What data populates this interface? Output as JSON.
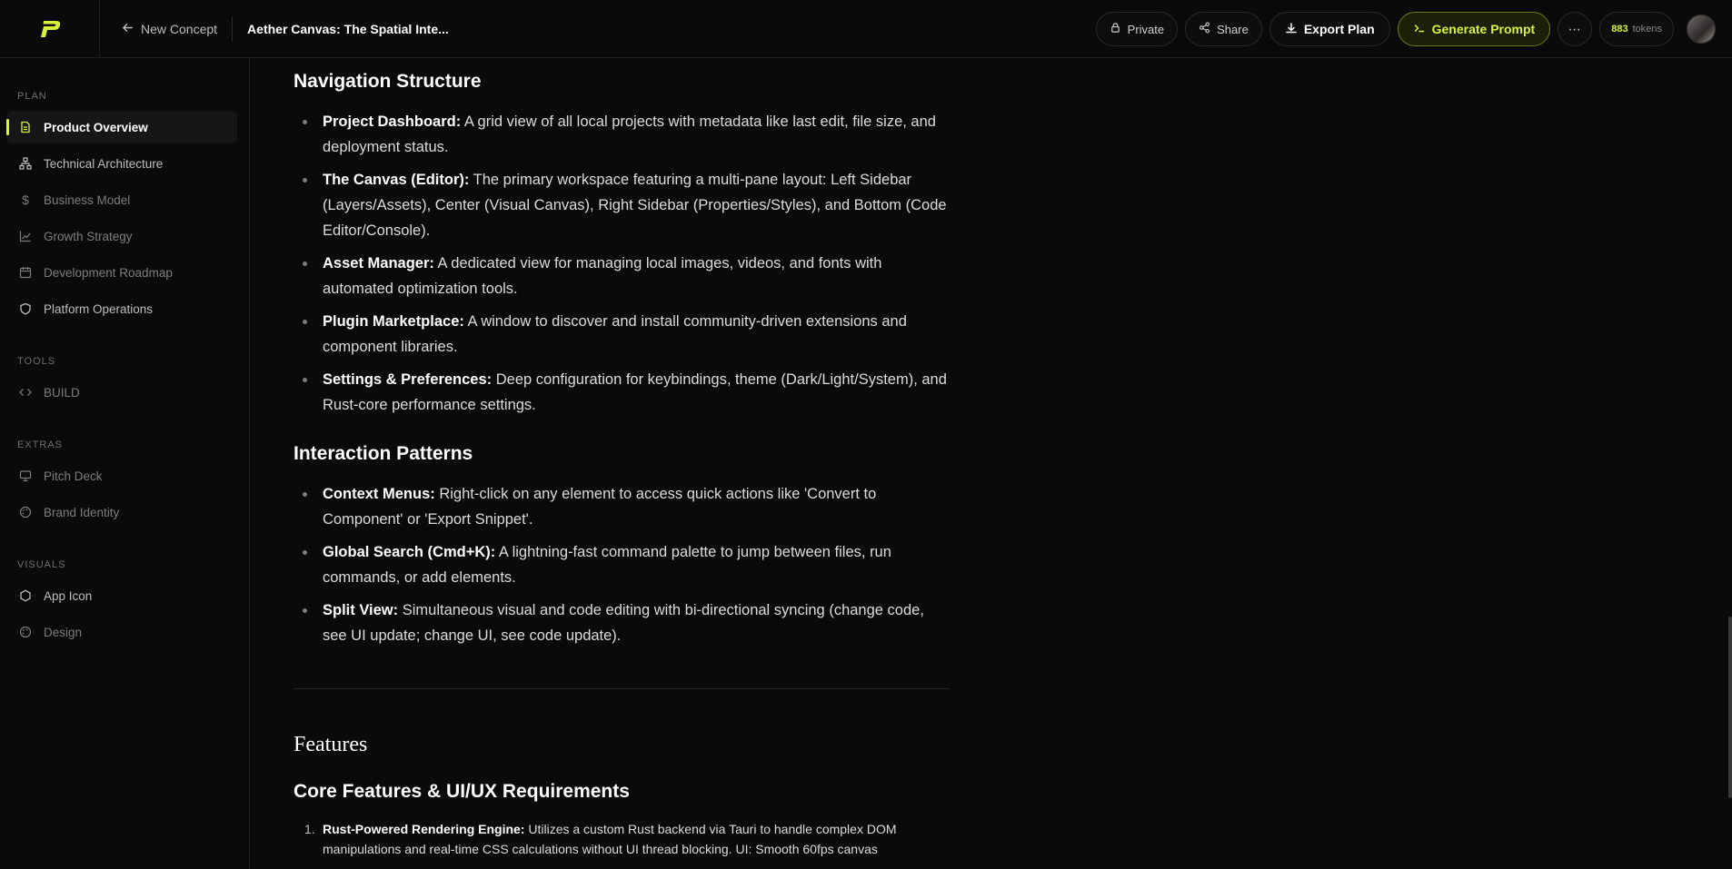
{
  "app": {
    "title": "Aether Canvas: The Spatial Inte...",
    "back_label": "New Concept"
  },
  "toolbar": {
    "private_label": "Private",
    "share_label": "Share",
    "export_label": "Export Plan",
    "generate_label": "Generate Prompt",
    "tokens_count": "883",
    "tokens_label": "tokens"
  },
  "colors": {
    "accent": "#d8f23a",
    "background": "#0a0a0a"
  },
  "sidebar": {
    "sections": [
      {
        "label": "PLAN",
        "items": [
          {
            "label": "Product Overview",
            "icon": "document-icon"
          },
          {
            "label": "Technical Architecture",
            "icon": "network-icon"
          },
          {
            "label": "Business Model",
            "icon": "dollar-icon"
          },
          {
            "label": "Growth Strategy",
            "icon": "chart-icon"
          },
          {
            "label": "Development Roadmap",
            "icon": "calendar-icon"
          },
          {
            "label": "Platform Operations",
            "icon": "shield-icon"
          }
        ]
      },
      {
        "label": "TOOLS",
        "items": [
          {
            "label": "BUILD",
            "icon": "code-icon"
          }
        ]
      },
      {
        "label": "EXTRAS",
        "items": [
          {
            "label": "Pitch Deck",
            "icon": "presentation-icon"
          },
          {
            "label": "Brand Identity",
            "icon": "palette-icon"
          }
        ]
      },
      {
        "label": "VISUALS",
        "items": [
          {
            "label": "App Icon",
            "icon": "hexagon-icon"
          },
          {
            "label": "Design",
            "icon": "palette-icon"
          }
        ]
      }
    ]
  },
  "main": {
    "navigation": {
      "heading": "Navigation Structure",
      "items": [
        {
          "term": "Project Dashboard:",
          "text": " A grid view of all local projects with metadata like last edit, file size, and deployment status."
        },
        {
          "term": "The Canvas (Editor):",
          "text": " The primary workspace featuring a multi-pane layout: Left Sidebar (Layers/Assets), Center (Visual Canvas), Right Sidebar (Properties/Styles), and Bottom (Code Editor/Console)."
        },
        {
          "term": "Asset Manager:",
          "text": " A dedicated view for managing local images, videos, and fonts with automated optimization tools."
        },
        {
          "term": "Plugin Marketplace:",
          "text": " A window to discover and install community-driven extensions and component libraries."
        },
        {
          "term": "Settings & Preferences:",
          "text": " Deep configuration for keybindings, theme (Dark/Light/System), and Rust-core performance settings."
        }
      ]
    },
    "interaction": {
      "heading": "Interaction Patterns",
      "items": [
        {
          "term": "Context Menus:",
          "text": " Right-click on any element to access quick actions like 'Convert to Component' or 'Export Snippet'."
        },
        {
          "term": "Global Search (Cmd+K):",
          "text": " A lightning-fast command palette to jump between files, run commands, or add elements."
        },
        {
          "term": "Split View:",
          "text": " Simultaneous visual and code editing with bi-directional syncing (change code, see UI update; change UI, see code update)."
        }
      ]
    },
    "features": {
      "section_title": "Features",
      "heading": "Core Features & UI/UX Requirements",
      "items": [
        {
          "num": "1.",
          "term": "Rust-Powered Rendering Engine:",
          "text": " Utilizes a custom Rust backend via Tauri to handle complex DOM manipulations and real-time CSS calculations without UI thread blocking. UI: Smooth 60fps canvas"
        }
      ]
    }
  }
}
